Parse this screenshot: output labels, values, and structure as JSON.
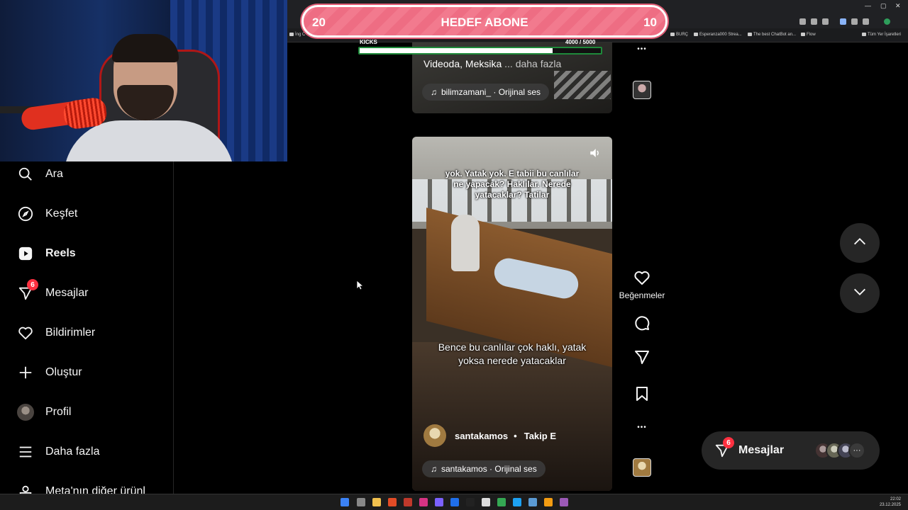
{
  "browser": {
    "bookmarks": [
      "İng C",
      "BURÇ",
      "Esperanza000 Strea...",
      "The best ChatBot an...",
      "Flow",
      "Tüm Yer İşaretleri"
    ],
    "window_controls": [
      "—",
      "▢",
      "✕"
    ]
  },
  "stream_overlay": {
    "goal_left": "20",
    "goal_title": "HEDEF ABONE",
    "goal_right": "10",
    "kicks_label": "KICKS",
    "kicks_count": "4000  / 5000",
    "kicks_progress": 0.8
  },
  "sidebar": {
    "items": [
      {
        "label": "Ara",
        "icon": "search-icon"
      },
      {
        "label": "Keşfet",
        "icon": "compass-icon"
      },
      {
        "label": "Reels",
        "icon": "reels-icon",
        "active": true
      },
      {
        "label": "Mesajlar",
        "icon": "messenger-icon",
        "badge": "6"
      },
      {
        "label": "Bildirimler",
        "icon": "heart-icon"
      },
      {
        "label": "Oluştur",
        "icon": "plus-icon"
      },
      {
        "label": "Profil",
        "icon": "avatar"
      },
      {
        "label": "Daha fazla",
        "icon": "menu-icon"
      },
      {
        "label": "Meta'nın diğer ürünl",
        "icon": "meta-icon"
      }
    ]
  },
  "reel_previous": {
    "caption": "Videoda, Meksika",
    "more": "... daha fazla",
    "audio": "bilimzamani_ · Orijinal ses"
  },
  "reel_current": {
    "caption_top": "yok. Yatak yok. E tabii bu canlılar ne yapacak? Haklılar. Nerede yatacaklar? Tatilar",
    "caption_bottom": "Bence bu canlılar çok haklı, yatak yoksa nerede yatacaklar",
    "author": "santakamos",
    "follow": "Takip E",
    "audio": "santakamos · Orijinal ses"
  },
  "actions": {
    "like_label": "Beğenmeler",
    "more": "•••"
  },
  "messages_pill": {
    "label": "Mesajlar",
    "badge": "6",
    "more": "···"
  },
  "taskbar": {
    "time": "22:02",
    "date": "23.12.2025"
  }
}
